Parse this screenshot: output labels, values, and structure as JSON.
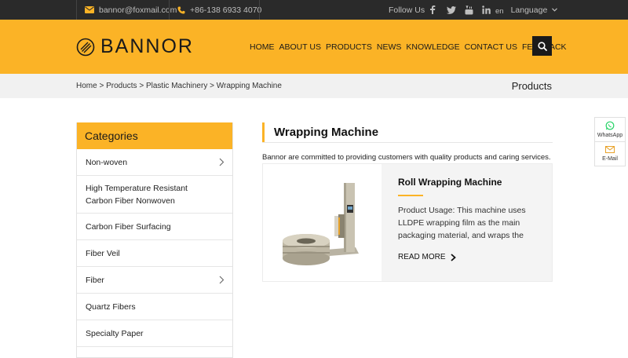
{
  "topbar": {
    "email": "bannor@foxmail.com",
    "phone": "+86-138 6933 4070",
    "follow_us": "Follow Us",
    "social": [
      "facebook-icon",
      "twitter-icon",
      "youtube-icon",
      "linkedin-icon"
    ],
    "lang_code": "en",
    "language_label": "Language"
  },
  "header": {
    "logo_text": "BANNOR",
    "nav": [
      "HOME",
      "ABOUT US",
      "PRODUCTS",
      "NEWS",
      "KNOWLEDGE",
      "CONTACT US",
      "FEEDBACK"
    ]
  },
  "breadcrumb": {
    "items": [
      "Home",
      "Products",
      "Plastic Machinery",
      "Wrapping Machine"
    ],
    "separator": " > ",
    "section_title": "Products"
  },
  "sidebar": {
    "title": "Categories",
    "items": [
      {
        "label": "Non-woven",
        "has_children": true
      },
      {
        "label": "High Temperature Resistant Carbon Fiber Nonwoven",
        "line1": "High Temperature Resistant",
        "line2": "Carbon Fiber Nonwoven",
        "has_children": false
      },
      {
        "label": "Carbon Fiber Surfacing",
        "has_children": false
      },
      {
        "label": "Fiber Veil",
        "has_children": false
      },
      {
        "label": "Fiber",
        "has_children": true
      },
      {
        "label": "Quartz Fibers",
        "has_children": false
      },
      {
        "label": "Specialty Paper",
        "has_children": false
      }
    ]
  },
  "main": {
    "title": "Wrapping Machine",
    "intro": "Bannor are committed to providing customers with quality products and caring services.",
    "product": {
      "name": "Roll Wrapping Machine",
      "description": "Product Usage: This machine uses LLDPE wrapping film as the main packaging material, and wraps the",
      "read_more": "READ MORE"
    }
  },
  "float": {
    "whatsapp": "WhatsApp",
    "email": "E-Mail"
  },
  "colors": {
    "accent": "#fbb326",
    "topbar": "#2a2a2a",
    "dark": "#1a1a1a",
    "whatsapp": "#25d366"
  }
}
